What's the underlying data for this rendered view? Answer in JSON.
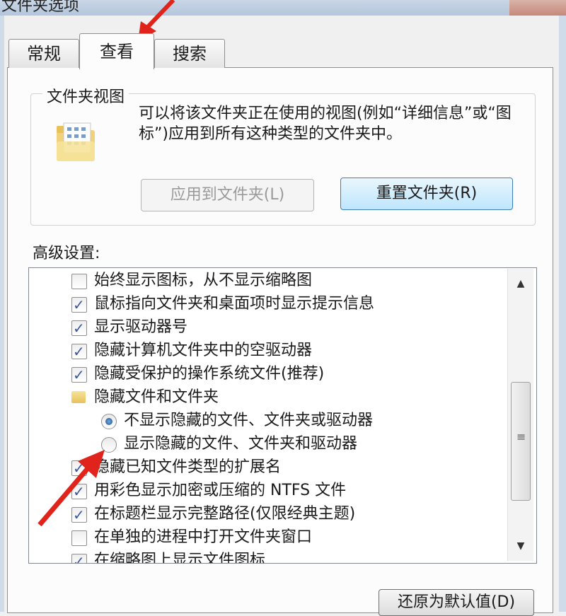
{
  "window": {
    "title": "文件夹选项"
  },
  "tabs": [
    "常规",
    "查看",
    "搜索"
  ],
  "folder_views": {
    "title": "文件夹视图",
    "description": "可以将该文件夹正在使用的视图(例如“详细信息”或“图标”)应用到所有这种类型的文件夹中。",
    "apply_button": "应用到文件夹(L)",
    "reset_button": "重置文件夹(R)"
  },
  "advanced": {
    "label": "高级设置:",
    "items": [
      {
        "type": "checkbox",
        "checked": false,
        "label": "始终显示图标，从不显示缩略图"
      },
      {
        "type": "checkbox",
        "checked": true,
        "label": "鼠标指向文件夹和桌面项时显示提示信息"
      },
      {
        "type": "checkbox",
        "checked": true,
        "label": "显示驱动器号"
      },
      {
        "type": "checkbox",
        "checked": true,
        "label": "隐藏计算机文件夹中的空驱动器"
      },
      {
        "type": "checkbox",
        "checked": true,
        "label": "隐藏受保护的操作系统文件(推荐)"
      },
      {
        "type": "folder",
        "label": "隐藏文件和文件夹"
      },
      {
        "type": "radio",
        "selected": true,
        "label": "不显示隐藏的文件、文件夹或驱动器"
      },
      {
        "type": "radio",
        "selected": false,
        "label": "显示隐藏的文件、文件夹和驱动器"
      },
      {
        "type": "checkbox",
        "checked": true,
        "label": "隐藏已知文件类型的扩展名"
      },
      {
        "type": "checkbox",
        "checked": true,
        "label": "用彩色显示加密或压缩的 NTFS 文件"
      },
      {
        "type": "checkbox",
        "checked": true,
        "label": "在标题栏显示完整路径(仅限经典主题)"
      },
      {
        "type": "checkbox",
        "checked": false,
        "label": "在单独的进程中打开文件夹窗口"
      },
      {
        "type": "checkbox",
        "checked": true,
        "label": "在缩略图上显示文件图标"
      }
    ]
  },
  "restore_button": "还原为默认值(D)",
  "colors": {
    "accent": "#3c7fb1",
    "annotation_arrow": "#e0231b"
  }
}
